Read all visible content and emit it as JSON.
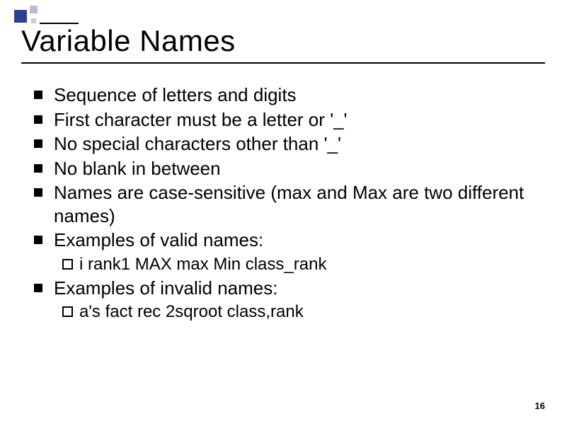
{
  "title": "Variable Names",
  "bullets": {
    "b0": "Sequence of letters and digits",
    "b1": "First character must be a letter or '_'",
    "b2": "No special characters other than '_'",
    "b3": "No blank in between",
    "b4": "Names are case-sensitive (max and Max are two different names)",
    "b5": "Examples of valid names:",
    "b5_sub": "i    rank1   MAX    max   Min    class_rank",
    "b6": "Examples of invalid names:",
    "b6_sub": "a's   fact rec   2sqroot     class,rank"
  },
  "page_number": "16"
}
